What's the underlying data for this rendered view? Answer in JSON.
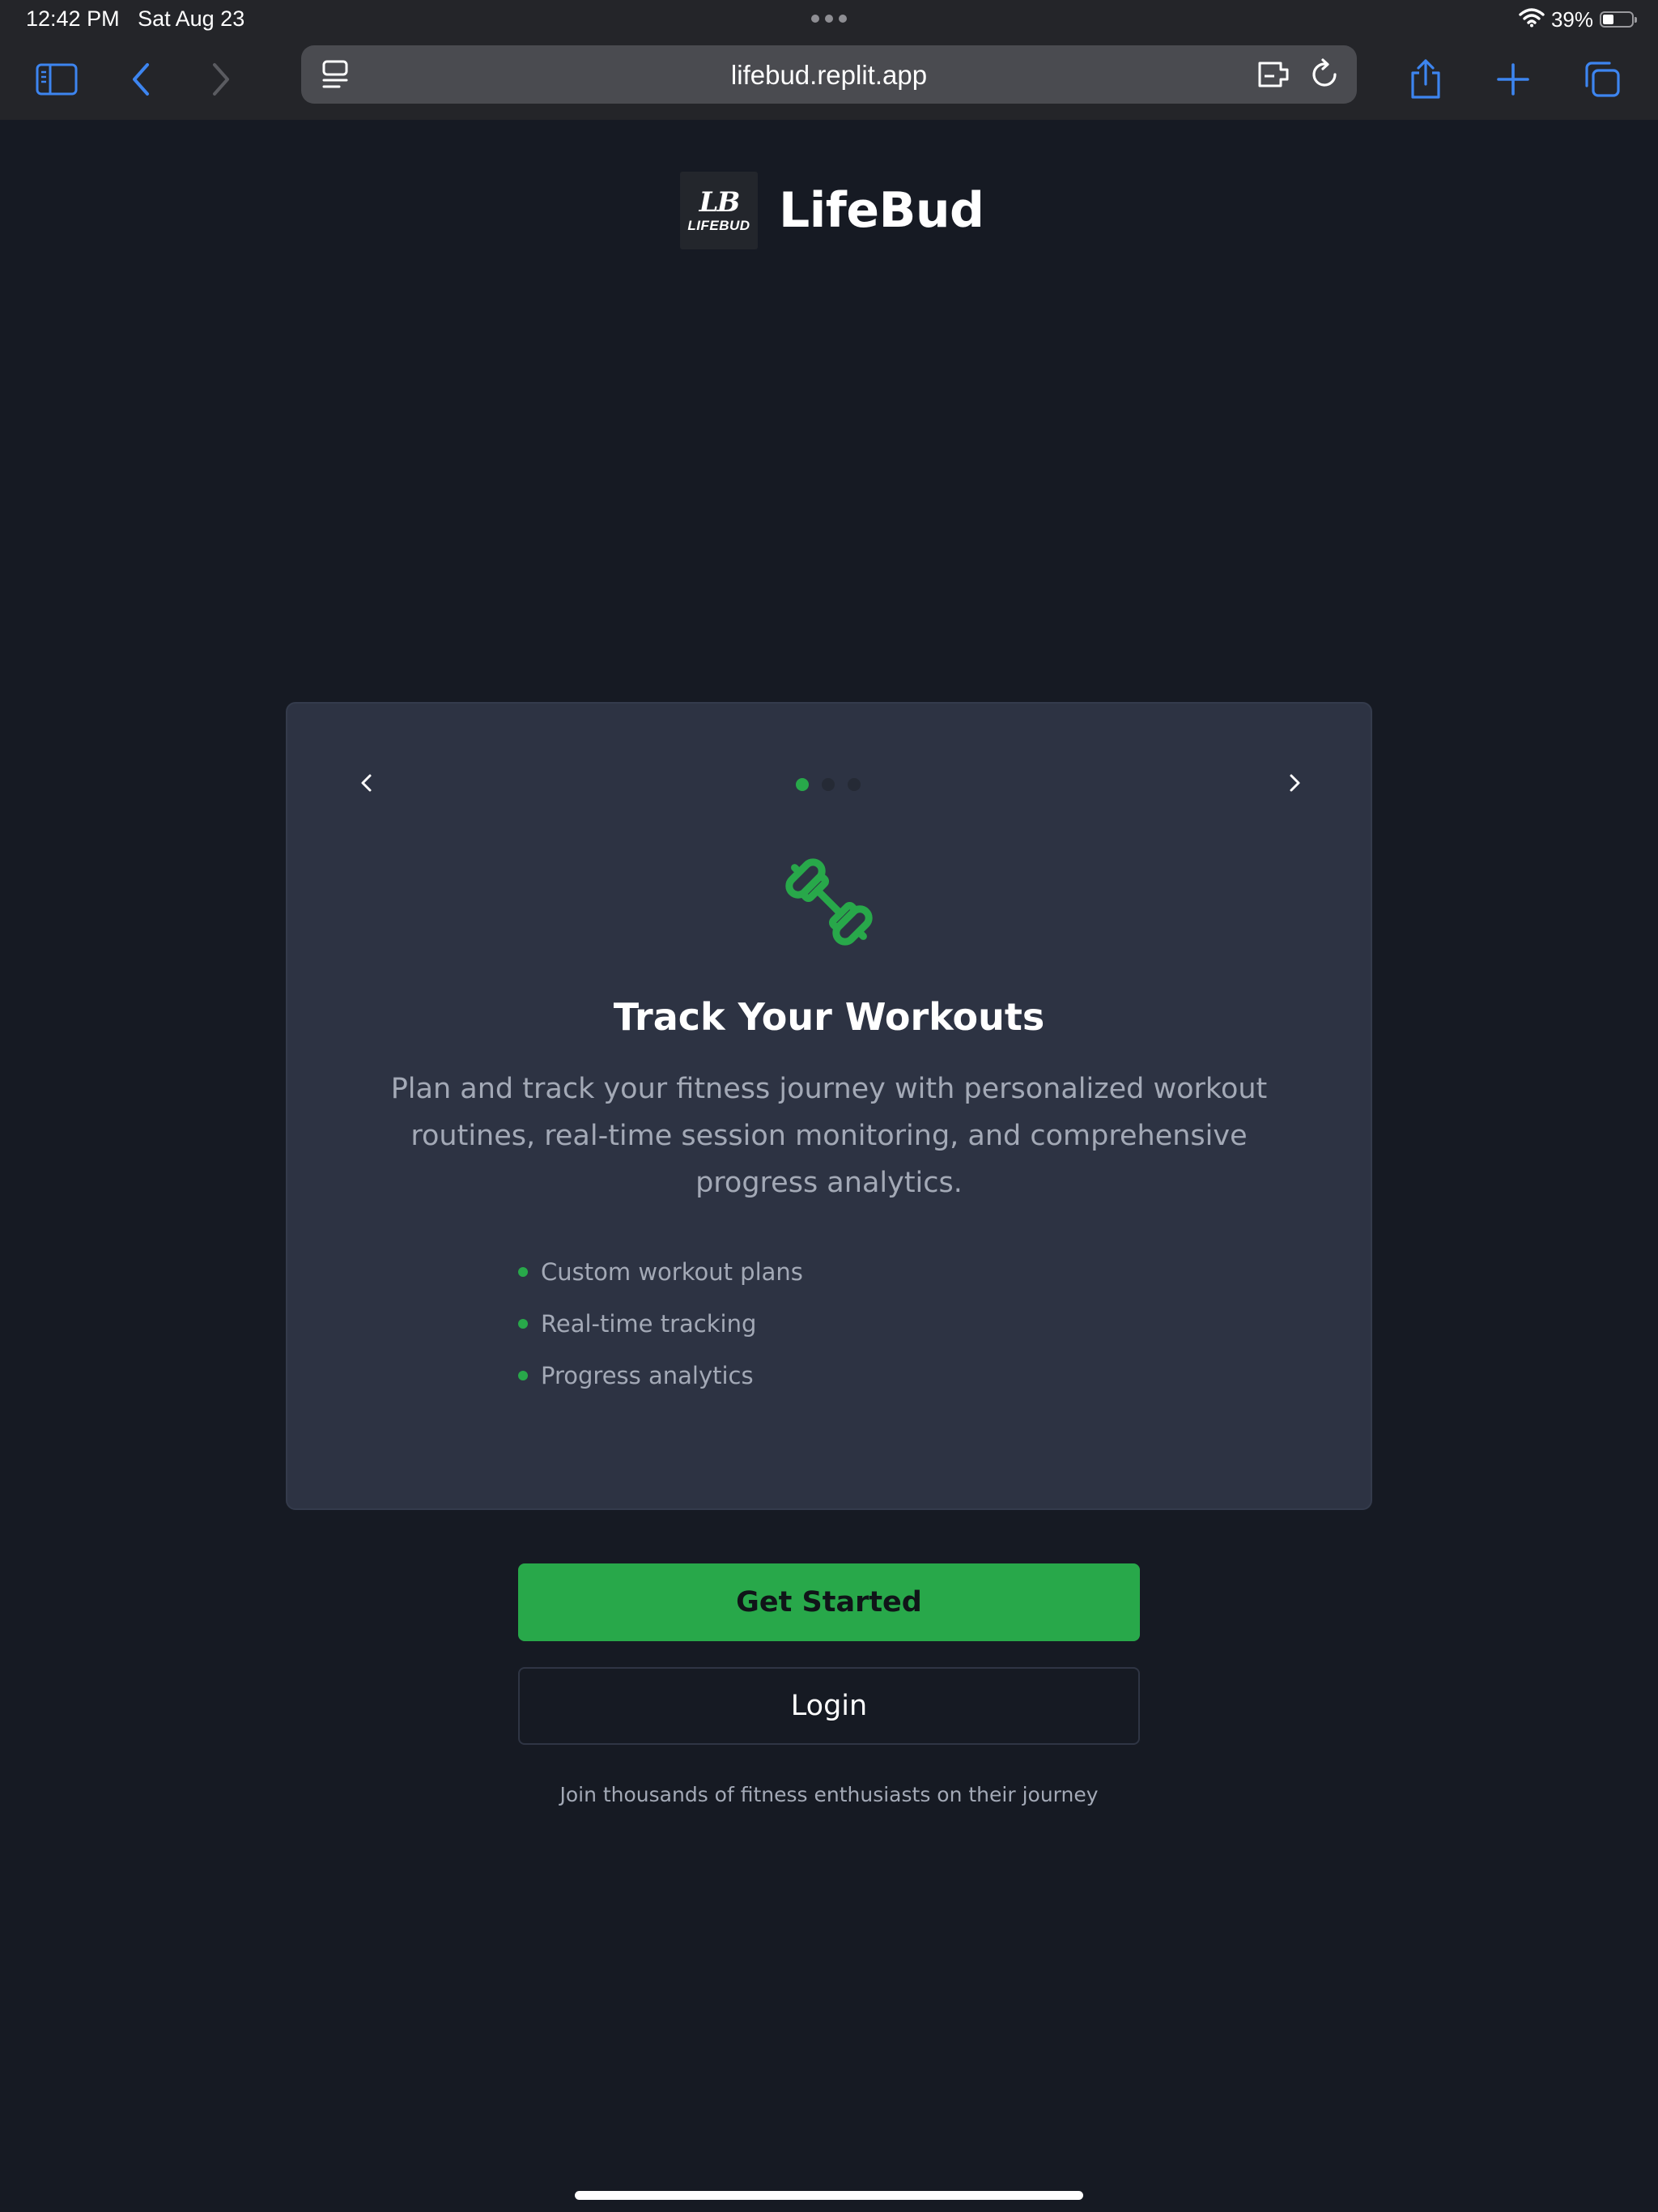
{
  "status_bar": {
    "time": "12:42 PM",
    "date": "Sat Aug 23",
    "battery_percent_label": "39%",
    "battery_level": 0.39,
    "icons": [
      "wifi-icon",
      "battery-icon"
    ]
  },
  "browser": {
    "url": "lifebud.replit.app",
    "buttons": [
      "sidebar-icon",
      "back-icon",
      "forward-icon",
      "reader-icon",
      "extension-icon",
      "reload-icon",
      "share-icon",
      "new-tab-icon",
      "tabs-icon"
    ],
    "accent_color": "#3d85f0"
  },
  "brand": {
    "logo_monogram": "LB",
    "logo_wordmark": "LIFEBUD",
    "name": "LifeBud"
  },
  "carousel": {
    "current_index": 0,
    "slide_count": 3,
    "active_dot_color": "#28a84a",
    "inactive_dot_color": "#252a35",
    "slide": {
      "icon": "dumbbell-icon",
      "title": "Track Your Workouts",
      "description": "Plan and track your fitness journey with personalized workout routines, real-time session monitoring, and comprehensive progress analytics.",
      "features": [
        "Custom workout plans",
        "Real-time tracking",
        "Progress analytics"
      ]
    }
  },
  "actions": {
    "get_started_label": "Get Started",
    "login_label": "Login"
  },
  "tagline": "Join thousands of fitness enthusiasts on their journey",
  "colors": {
    "background": "#161a23",
    "card": "#2d3343",
    "primary": "#28a84a",
    "muted_text": "#a3a9b6"
  }
}
